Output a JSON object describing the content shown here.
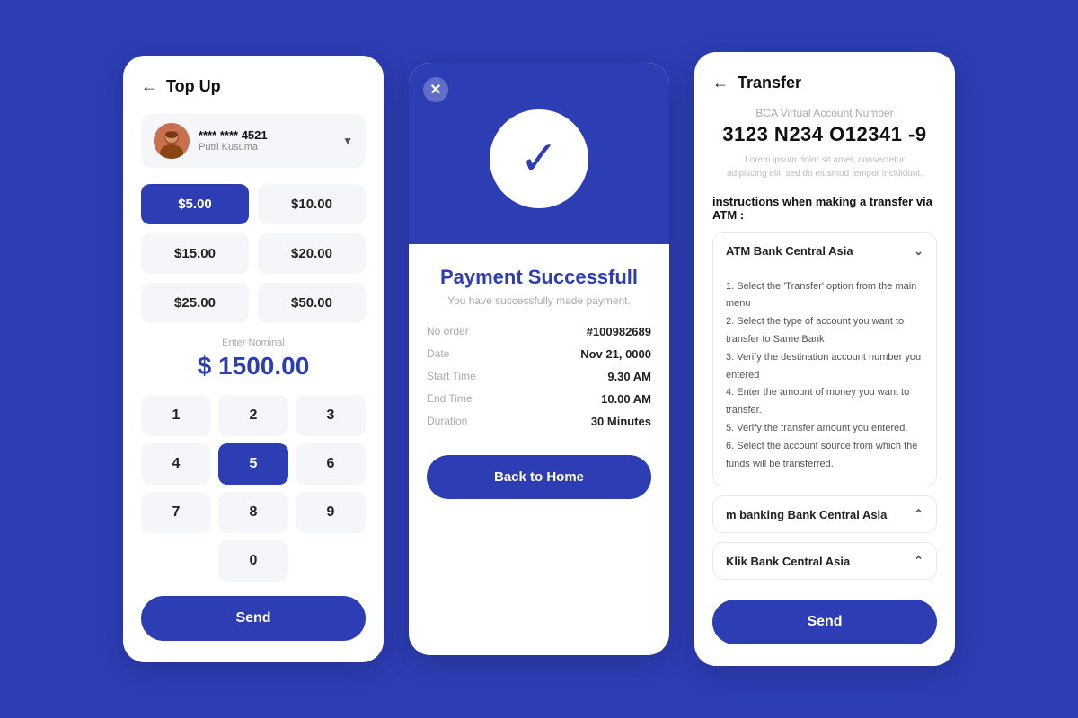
{
  "panel1": {
    "title": "Top Up",
    "account_number": "**** **** 4521",
    "account_name": "Putri Kusuma",
    "amounts": [
      "$5.00",
      "$10.00",
      "$15.00",
      "$20.00",
      "$25.00",
      "$50.00"
    ],
    "active_amount_index": 0,
    "nominal_label": "Enter Nominal",
    "nominal_value": "$ 1500.00",
    "numpad": [
      "1",
      "2",
      "3",
      "4",
      "5",
      "6",
      "7",
      "8",
      "9",
      "0"
    ],
    "active_num": "5",
    "send_label": "Send"
  },
  "panel2": {
    "title": "Payment Successfull",
    "subtitle": "You have successfully made payment.",
    "details": [
      {
        "label": "No order",
        "value": "#100982689"
      },
      {
        "label": "Date",
        "value": "Nov 21, 0000"
      },
      {
        "label": "Start Time",
        "value": "9.30 AM"
      },
      {
        "label": "End Time",
        "value": "10.00 AM"
      },
      {
        "label": "Duration",
        "value": "30 Minutes"
      }
    ],
    "back_home_label": "Back to Home"
  },
  "panel3": {
    "title": "Transfer",
    "virtual_account_label": "BCA Virtual Account Number",
    "virtual_number": "3123 N234 O12341 -9",
    "virtual_desc": "Lorem ipsum dolor sit amet, consectetur\nadipiscing elit, sed do eiusmod tempor incididunt.",
    "instructions_label": "instructions when making a transfer via ATM :",
    "accordions": [
      {
        "title": "ATM Bank Central Asia",
        "open": false,
        "steps": [
          "1. Select the 'Transfer' option from the main menu",
          "2. Select the type of account you want to transfer to Same Bank",
          "3. Verify the destination account number you entered",
          "4. Enter the amount of money you want to transfer.",
          "5. Verify the transfer amount you entered.",
          "6. Select the account source from which the funds will be transferred."
        ]
      },
      {
        "title": "m banking Bank Central Asia",
        "open": true,
        "steps": []
      },
      {
        "title": "Klik Bank Central Asia",
        "open": true,
        "steps": []
      }
    ],
    "send_label": "Send"
  }
}
